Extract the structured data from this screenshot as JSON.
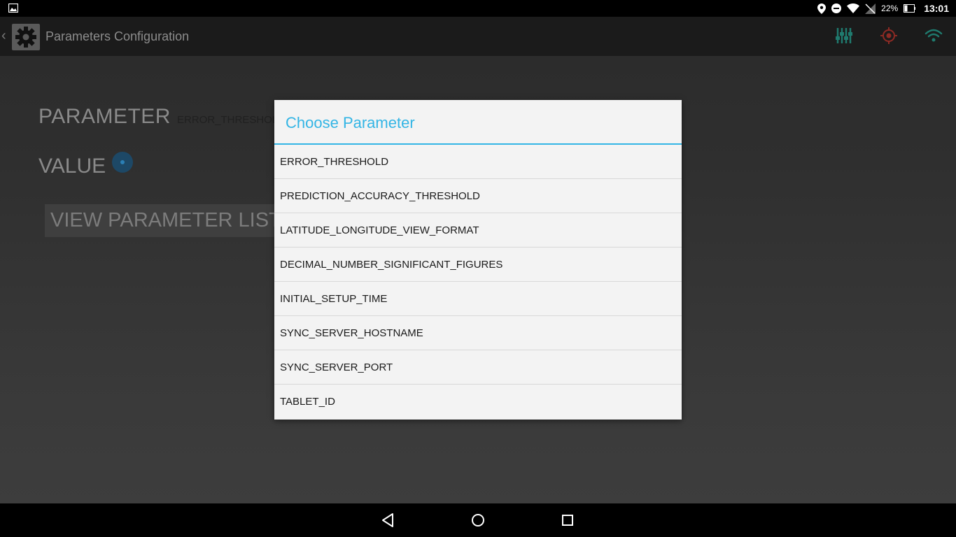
{
  "status_bar": {
    "battery_percent": "22%",
    "time": "13:01"
  },
  "action_bar": {
    "title": "Parameters Configuration",
    "icons": [
      "sliders-icon",
      "target-icon",
      "wifi-icon"
    ]
  },
  "main": {
    "parameter_label": "PARAMETER",
    "parameter_value": "ERROR_THRESHOL",
    "value_label": "VALUE",
    "view_list_button": "VIEW PARAMETER LIST"
  },
  "dialog": {
    "title": "Choose Parameter",
    "items": [
      "ERROR_THRESHOLD",
      "PREDICTION_ACCURACY_THRESHOLD",
      "LATITUDE_LONGITUDE_VIEW_FORMAT",
      "DECIMAL_NUMBER_SIGNIFICANT_FIGURES",
      "INITIAL_SETUP_TIME",
      "SYNC_SERVER_HOSTNAME",
      "SYNC_SERVER_PORT",
      "TABLET_ID"
    ]
  },
  "colors": {
    "accent": "#33b5e5",
    "target_icon": "#c0392b",
    "teal_icons": "#2a8c7e"
  }
}
